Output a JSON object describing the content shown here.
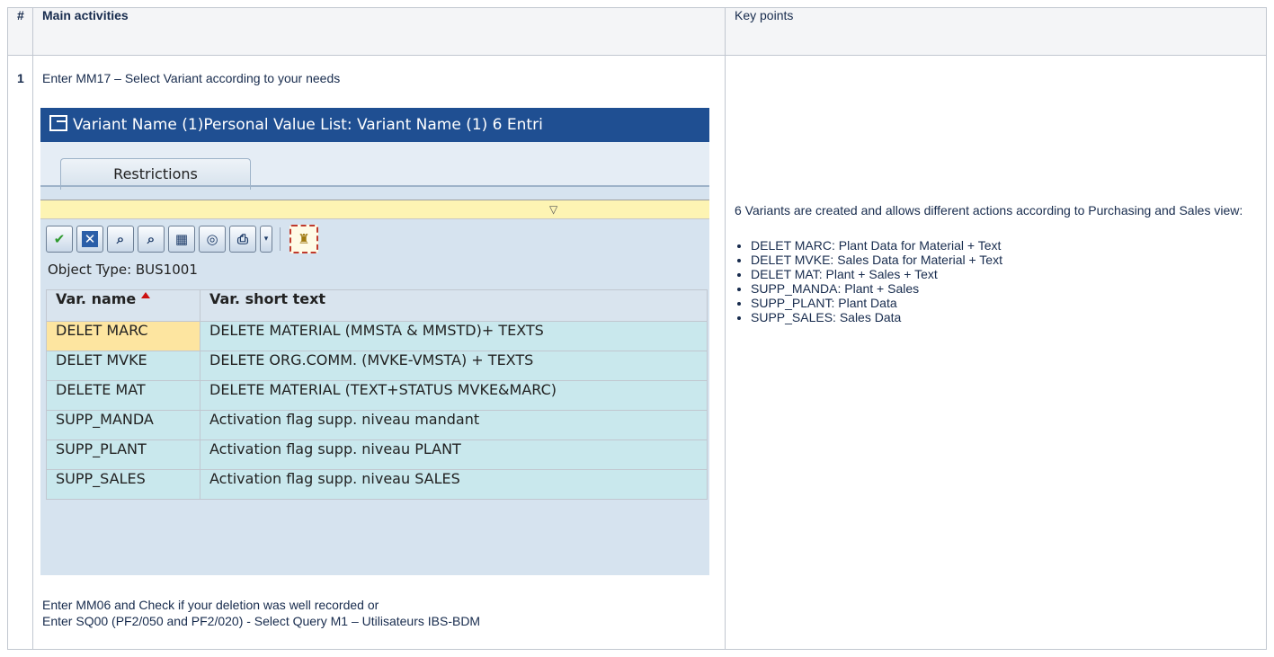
{
  "table": {
    "headers": {
      "num": "#",
      "activities": "Main activities",
      "keypoints": "Key points"
    },
    "row1": {
      "num": "1",
      "intro": "Enter MM17 – Select Variant according to your needs",
      "after_line1": "Enter MM06 and Check if your deletion was well recorded or",
      "after_line2": "Enter SQ00 (PF2/050 and PF2/020) - Select Query M1 – Utilisateurs IBS-BDM"
    }
  },
  "sap": {
    "title": "Variant Name (1)Personal Value List: Variant Name (1)   6 Entri",
    "tab": "Restrictions",
    "object_type": "Object Type: BUS1001",
    "columns": [
      "Var. name",
      "Var. short text"
    ],
    "rows": [
      {
        "name": "DELET MARC",
        "text": "DELETE MATERIAL (MMSTA & MMSTD)+ TEXTS"
      },
      {
        "name": "DELET MVKE",
        "text": "DELETE ORG.COMM. (MVKE-VMSTA) + TEXTS"
      },
      {
        "name": "DELETE MAT",
        "text": "DELETE MATERIAL (TEXT+STATUS MVKE&MARC)"
      },
      {
        "name": "SUPP_MANDA",
        "text": "Activation flag supp. niveau mandant"
      },
      {
        "name": "SUPP_PLANT",
        "text": "Activation flag supp. niveau  PLANT"
      },
      {
        "name": "SUPP_SALES",
        "text": "Activation flag supp. niveau  SALES"
      }
    ],
    "colors": {
      "title_bar": "#1f4f92",
      "row_bg": "#c9e8ed",
      "selected_row": "#fde5a0"
    }
  },
  "keypoints": {
    "intro": "6 Variants are created and allows different actions according to Purchasing and Sales view:",
    "items": [
      "DELET MARC: Plant Data for Material + Text",
      "DELET MVKE: Sales Data for Material + Text",
      "DELET MAT: Plant + Sales + Text",
      "SUPP_MANDA: Plant + Sales",
      "SUPP_PLANT: Plant Data",
      "SUPP_SALES: Sales Data"
    ]
  },
  "icons": [
    "check-icon",
    "cancel-icon",
    "find-icon",
    "find-next-icon",
    "select-icon",
    "display-icon",
    "print-icon",
    "dropdown-icon",
    "personal-list-icon"
  ]
}
